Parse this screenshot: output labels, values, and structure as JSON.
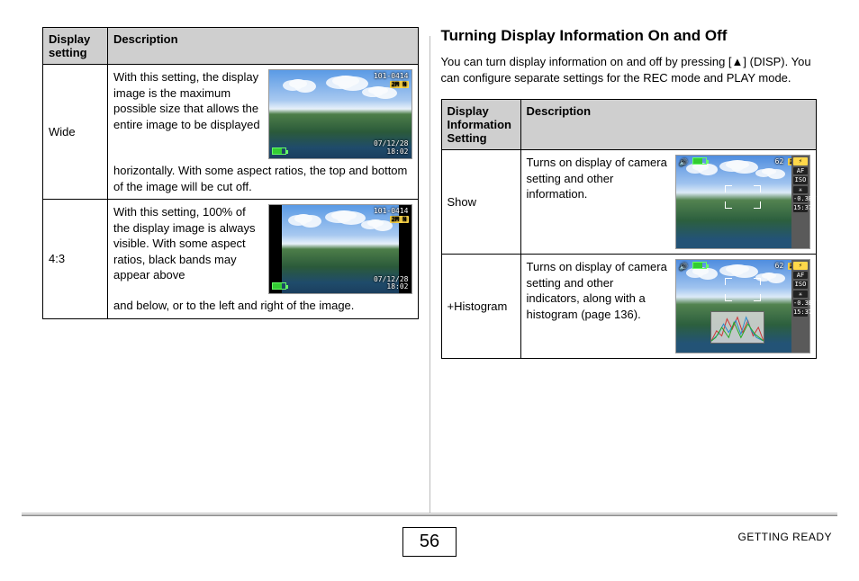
{
  "left_table": {
    "headers": {
      "col1": "Display setting",
      "col2": "Description"
    },
    "rows": [
      {
        "setting": "Wide",
        "desc_top": "With this setting, the display image is the maximum possible size that allows the entire image to be displayed",
        "desc_rest": "horizontally. With some aspect ratios, the top and bottom of the image will be cut off.",
        "osd": {
          "tr_line1": "101-0414",
          "tr_line2": "2M N",
          "br_line1": "07/12/28",
          "br_line2": "18:02"
        }
      },
      {
        "setting": "4:3",
        "desc_top": "With this setting, 100% of the display image is always visible. With some aspect ratios, black bands may appear above",
        "desc_rest": "and below, or to the left and right of the image.",
        "osd": {
          "tr_line1": "101-0414",
          "tr_line2": "2M N",
          "br_line1": "07/12/28",
          "br_line2": "18:02"
        }
      }
    ]
  },
  "right": {
    "heading": "Turning Display Information On and Off",
    "intro": "You can turn display information on and off by pressing [▲] (DISP). You can configure separate settings for the REC mode and PLAY mode.",
    "headers": {
      "col1": "Display Information Setting",
      "col2": "Description"
    },
    "rows": [
      {
        "setting": "Show",
        "desc": "Turns on display of camera setting and other information.",
        "osd": {
          "tl": "62",
          "tr": "2M N",
          "sb": [
            "⚡",
            "AF",
            "ISO",
            "✳",
            "-0.3EV",
            "15:37"
          ]
        }
      },
      {
        "setting": "+Histogram",
        "desc": "Turns on display of camera setting and other indicators, along with a histogram (page 136).",
        "osd": {
          "tl": "62",
          "tr": "2M N",
          "sb": [
            "⚡",
            "AF",
            "ISO",
            "✳",
            "-0.3EV",
            "15:37"
          ]
        }
      }
    ]
  },
  "footer": {
    "page_number": "56",
    "section": "GETTING READY"
  }
}
